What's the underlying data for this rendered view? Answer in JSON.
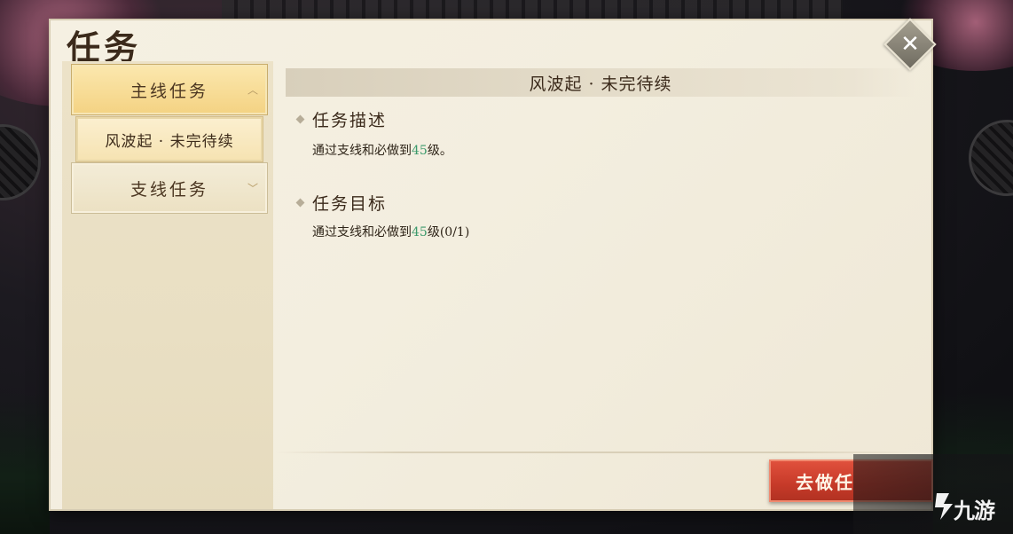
{
  "panel": {
    "title": "任务"
  },
  "close_button": {
    "icon": "close-icon"
  },
  "sidebar": {
    "categories": [
      {
        "label": "主线任务",
        "state": "expanded"
      },
      {
        "label": "支线任务",
        "state": "collapsed"
      }
    ],
    "main_items": [
      {
        "label": "风波起 · 未完待续",
        "selected": true
      }
    ]
  },
  "detail": {
    "header": "风波起 · 未完待续",
    "description": {
      "heading": "任务描述",
      "text_before": "通过支线和必做到",
      "level": "45",
      "text_after": "级。"
    },
    "objective": {
      "heading": "任务目标",
      "text_before": "通过支线和必做到",
      "level": "45",
      "text_after": "级",
      "progress": "(0/1)"
    }
  },
  "action_button": {
    "label": "去做任"
  },
  "watermark": {
    "text": "九游"
  },
  "colors": {
    "highlight": "#3c9a6c",
    "action": "#c63a29",
    "panel": "#f3eedf"
  }
}
